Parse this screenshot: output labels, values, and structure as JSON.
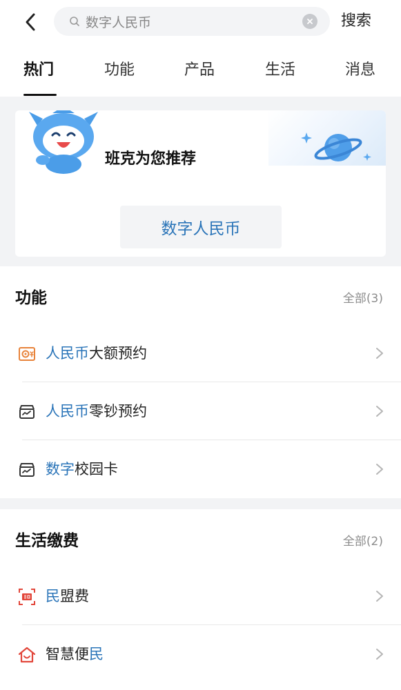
{
  "search": {
    "query": "数字人民币",
    "submit_label": "搜索"
  },
  "tabs": [
    {
      "label": "热门",
      "active": true
    },
    {
      "label": "功能",
      "active": false
    },
    {
      "label": "产品",
      "active": false
    },
    {
      "label": "生活",
      "active": false
    },
    {
      "label": "消息",
      "active": false
    }
  ],
  "recommend": {
    "title": "班克为您推荐",
    "chip_label": "数字人民币"
  },
  "functions": {
    "title": "功能",
    "all_label": "全部(3)",
    "items": [
      {
        "highlight": "人民币",
        "rest": "大额预约",
        "icon": "cash-reserve-icon"
      },
      {
        "highlight": "人民币",
        "rest": "零钞预约",
        "icon": "wallet-icon"
      },
      {
        "highlight": "数字",
        "rest": "校园卡",
        "icon": "wallet-icon"
      }
    ]
  },
  "life": {
    "title": "生活缴费",
    "all_label": "全部(2)",
    "items": [
      {
        "prefix": "",
        "highlight": "民",
        "rest": "盟费",
        "icon": "minmeng-icon"
      },
      {
        "prefix": "智慧便",
        "highlight": "民",
        "rest": "",
        "icon": "home-icon"
      }
    ]
  },
  "colors": {
    "accent_blue": "#2a74b8",
    "red_icon": "#e2463a",
    "orange_icon": "#e8833a",
    "background": "#f2f3f5"
  }
}
